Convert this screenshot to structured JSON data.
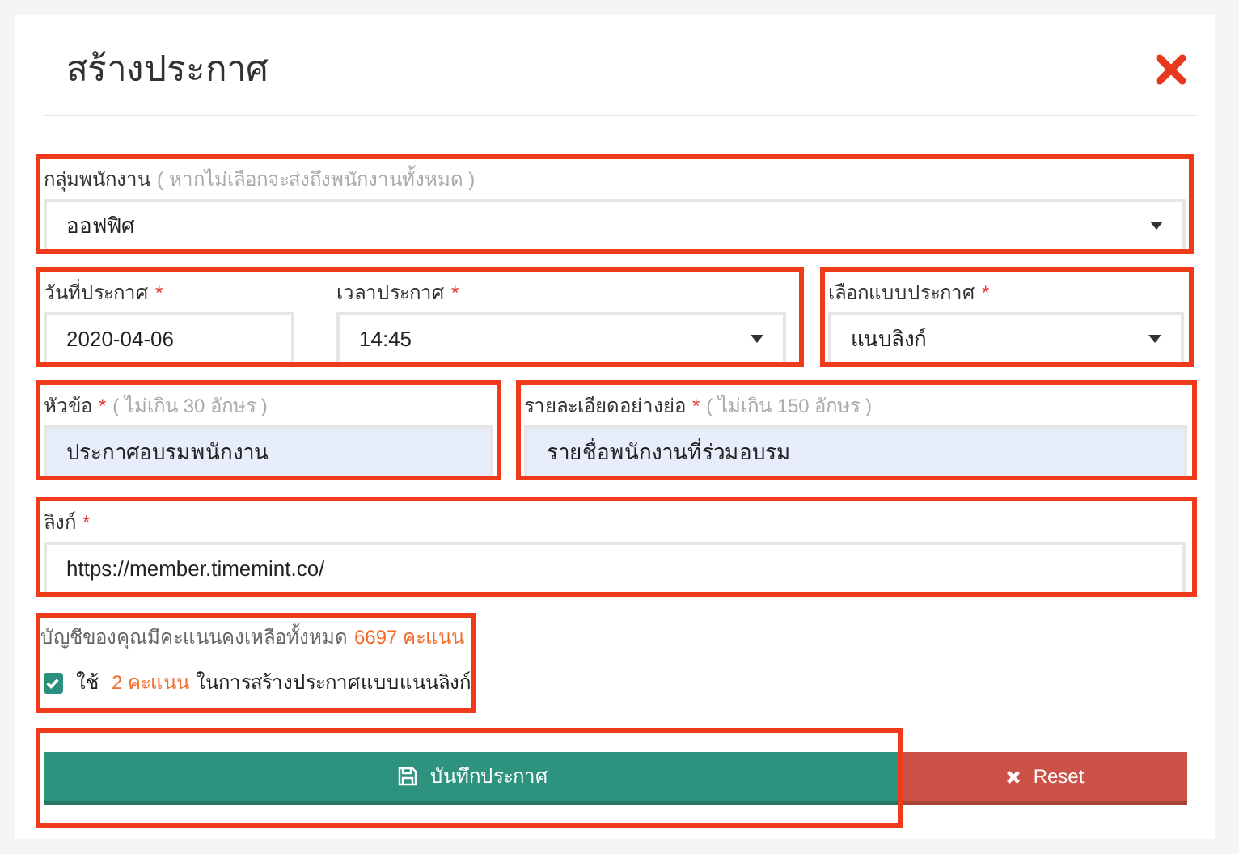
{
  "title": "สร้างประกาศ",
  "rows": [
    {
      "frames": [
        {
          "fields": [
            {
              "kind": "select",
              "label": "กลุ่มพนักงาน",
              "hint": "( หากไม่เลือกจะส่งถึงพนักงานทั้งหมด )",
              "value": "ออฟฟิศ",
              "filled": false
            }
          ]
        }
      ]
    },
    {
      "frames": [
        {
          "fields": [
            {
              "kind": "text",
              "label": "วันที่ประกาศ",
              "mark": "*",
              "value": "2020-04-06",
              "filled": false
            },
            {
              "kind": "select",
              "label": "เวลาประกาศ",
              "mark": "*",
              "value": "14:45",
              "filled": false
            }
          ]
        },
        {
          "fields": [
            {
              "kind": "select",
              "label": "เลือกแบบประกาศ",
              "mark": "*",
              "value": "แนบลิงก์",
              "filled": false
            }
          ]
        }
      ]
    },
    {
      "frames": [
        {
          "fields": [
            {
              "kind": "text",
              "label": "หัวข้อ",
              "mark": "*",
              "hint": "( ไม่เกิน 30 อักษร )",
              "value": "ประกาศอบรมพนักงาน",
              "filled": true
            }
          ]
        },
        {
          "fields": [
            {
              "kind": "text",
              "label": "รายละเอียดอย่างย่อ",
              "mark": "*",
              "hint": "( ไม่เกิน 150 อักษร )",
              "value": "รายชื่อพนักงานที่ร่วมอบรม",
              "filled": true
            }
          ]
        }
      ]
    },
    {
      "frames": [
        {
          "fields": [
            {
              "kind": "text",
              "label": "ลิงก์",
              "mark": "*",
              "value": "https://member.timemint.co/",
              "filled": false
            }
          ]
        }
      ]
    }
  ],
  "points": {
    "text": "บัญชีของคุณมีคะแนนคงเหลือทั้งหมด",
    "amount": "6697 คะแนน"
  },
  "use_points": {
    "checked": true,
    "before": "ใช้",
    "amount": "2 คะแนน",
    "after": "ในการสร้างประกาศแบบแนนลิงก์"
  },
  "buttons": [
    {
      "kind": "save",
      "label": "บันทึกประกาศ"
    },
    {
      "kind": "reset",
      "label": "Reset"
    }
  ]
}
